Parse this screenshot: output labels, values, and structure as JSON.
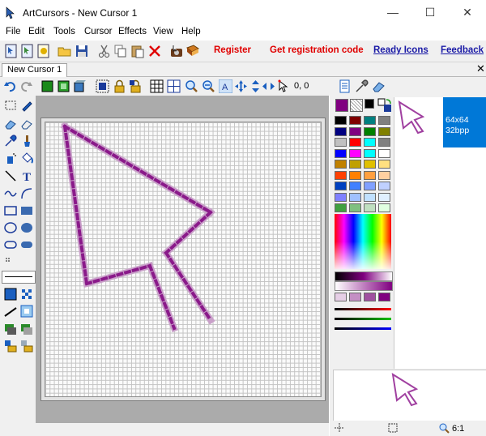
{
  "window": {
    "title": "ArtCursors - New Cursor 1",
    "minimize_glyph": "—",
    "maximize_glyph": "☐",
    "close_glyph": "✕"
  },
  "menu": [
    "File",
    "Edit",
    "Tools",
    "Cursor",
    "Effects",
    "View",
    "Help"
  ],
  "toolbar": {
    "register": "Register",
    "get_code": "Get registration code",
    "ready_icons": "Ready Icons",
    "feedback": "Feedback"
  },
  "document": {
    "tab_label": "New Cursor 1",
    "tab_close_glyph": "✕"
  },
  "toolbar2": {
    "coords": "0, 0"
  },
  "info": {
    "size": "64x64",
    "depth": "32bpp"
  },
  "status": {
    "zoom": "6:1"
  },
  "colors": {
    "brand_purple": "#800080",
    "accent_blue": "#0078d7",
    "link_red": "#e00000",
    "link_blue": "#1a1aa6"
  }
}
